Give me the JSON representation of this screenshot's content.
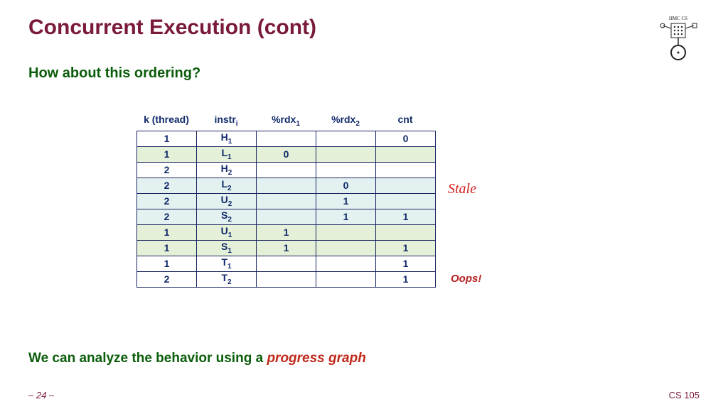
{
  "title": "Concurrent Execution (cont)",
  "subtitle": "How about this ordering?",
  "headers": {
    "c0": "k (thread)",
    "c1_base": "instr",
    "c1_sub": "i",
    "c2_base": "%rdx",
    "c2_sub": "1",
    "c3_base": "%rdx",
    "c3_sub": "2",
    "c4": "cnt"
  },
  "chart_data": {
    "type": "table",
    "title": "Thread interleaving trace",
    "columns": [
      "k (thread)",
      "instr_i",
      "%rdx_1",
      "%rdx_2",
      "cnt"
    ],
    "rows": [
      {
        "k": "1",
        "instr_base": "H",
        "instr_sub": "1",
        "rdx1": "",
        "rdx2": "",
        "cnt": "0",
        "shade": ""
      },
      {
        "k": "1",
        "instr_base": "L",
        "instr_sub": "1",
        "rdx1": "0",
        "rdx2": "",
        "cnt": "",
        "shade": "green"
      },
      {
        "k": "2",
        "instr_base": "H",
        "instr_sub": "2",
        "rdx1": "",
        "rdx2": "",
        "cnt": "",
        "shade": ""
      },
      {
        "k": "2",
        "instr_base": "L",
        "instr_sub": "2",
        "rdx1": "",
        "rdx2": "0",
        "cnt": "",
        "shade": "blue"
      },
      {
        "k": "2",
        "instr_base": "U",
        "instr_sub": "2",
        "rdx1": "",
        "rdx2": "1",
        "cnt": "",
        "shade": "blue"
      },
      {
        "k": "2",
        "instr_base": "S",
        "instr_sub": "2",
        "rdx1": "",
        "rdx2": "1",
        "cnt": "1",
        "shade": "blue"
      },
      {
        "k": "1",
        "instr_base": "U",
        "instr_sub": "1",
        "rdx1": "1",
        "rdx2": "",
        "cnt": "",
        "shade": "green"
      },
      {
        "k": "1",
        "instr_base": "S",
        "instr_sub": "1",
        "rdx1": "1",
        "rdx2": "",
        "cnt": "1",
        "shade": "green"
      },
      {
        "k": "1",
        "instr_base": "T",
        "instr_sub": "1",
        "rdx1": "",
        "rdx2": "",
        "cnt": "1",
        "shade": ""
      },
      {
        "k": "2",
        "instr_base": "T",
        "instr_sub": "2",
        "rdx1": "",
        "rdx2": "",
        "cnt": "1",
        "shade": ""
      }
    ]
  },
  "annotation": "Stale",
  "oops": "Oops!",
  "bottom": {
    "green": "We can analyze the behavior using a ",
    "red": "progress graph"
  },
  "pagenum": "– 24 –",
  "course": "CS 105",
  "logo_text": "HMC CS"
}
